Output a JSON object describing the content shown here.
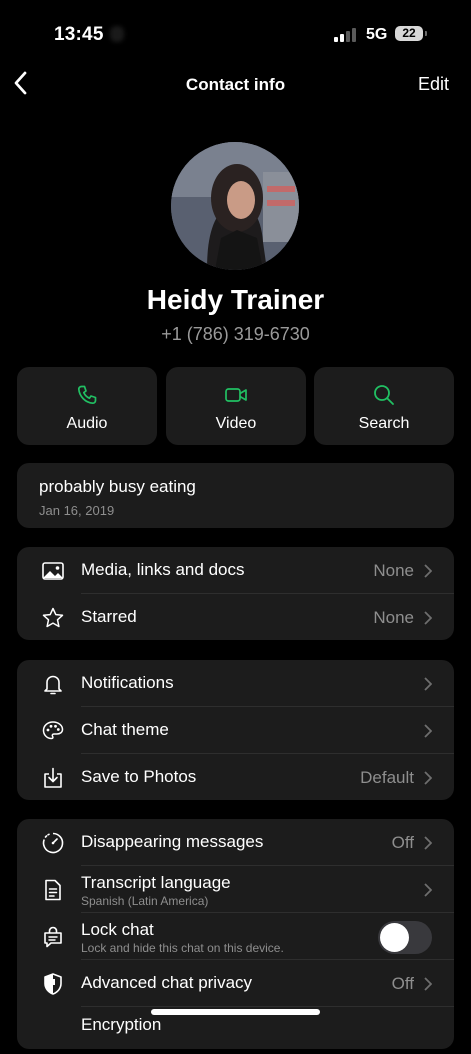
{
  "status_bar": {
    "time": "13:45",
    "network": "5G",
    "battery": "22"
  },
  "nav": {
    "title": "Contact info",
    "edit_label": "Edit"
  },
  "profile": {
    "name": "Heidy Trainer",
    "phone": "+1 (786) 319-6730"
  },
  "actions": [
    {
      "label": "Audio",
      "icon": "phone-icon"
    },
    {
      "label": "Video",
      "icon": "video-icon"
    },
    {
      "label": "Search",
      "icon": "search-icon"
    }
  ],
  "about": {
    "text": "probably busy eating",
    "date": "Jan 16, 2019"
  },
  "group1": [
    {
      "label": "Media, links and docs",
      "value": "None",
      "icon": "image-icon"
    },
    {
      "label": "Starred",
      "value": "None",
      "icon": "star-icon"
    }
  ],
  "group2": [
    {
      "label": "Notifications",
      "value": "",
      "icon": "bell-icon"
    },
    {
      "label": "Chat theme",
      "value": "",
      "icon": "palette-icon"
    },
    {
      "label": "Save to Photos",
      "value": "Default",
      "icon": "save-icon"
    }
  ],
  "group3": [
    {
      "label": "Disappearing messages",
      "value": "Off",
      "icon": "timer-icon"
    },
    {
      "label": "Transcript language",
      "sub": "Spanish (Latin America)",
      "icon": "document-icon"
    },
    {
      "label": "Lock chat",
      "sub": "Lock and hide this chat on this device.",
      "icon": "lock-chat-icon",
      "toggle_on": false
    },
    {
      "label": "Advanced chat privacy",
      "value": "Off",
      "icon": "shield-icon"
    },
    {
      "label": "Encryption",
      "icon": "encryption-icon"
    }
  ],
  "colors": {
    "accent": "#21c063",
    "card": "#1c1c1c",
    "secondary_text": "#8e8e8e"
  }
}
